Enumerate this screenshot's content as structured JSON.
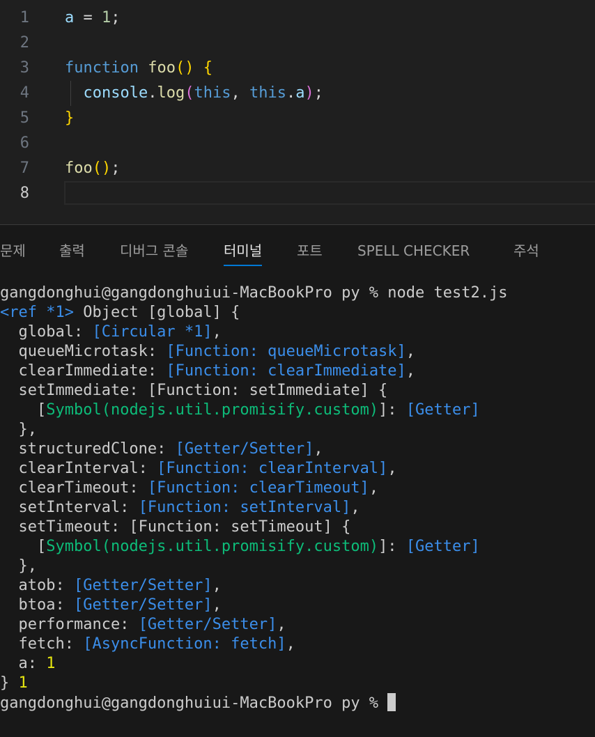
{
  "editor": {
    "active_line": 8,
    "lines": [
      {
        "no": "1",
        "tokens": [
          {
            "t": "a",
            "c": "var"
          },
          {
            "t": " = ",
            "c": "pn"
          },
          {
            "t": "1",
            "c": "num"
          },
          {
            "t": ";",
            "c": "pn"
          }
        ]
      },
      {
        "no": "2",
        "tokens": []
      },
      {
        "no": "3",
        "tokens": [
          {
            "t": "function",
            "c": "kw"
          },
          {
            "t": " ",
            "c": "pn"
          },
          {
            "t": "foo",
            "c": "fn"
          },
          {
            "t": "()",
            "c": "br1"
          },
          {
            "t": " ",
            "c": "pn"
          },
          {
            "t": "{",
            "c": "br1"
          }
        ]
      },
      {
        "no": "4",
        "tokens": [
          {
            "t": "  ",
            "c": "pn"
          },
          {
            "t": "console",
            "c": "var"
          },
          {
            "t": ".",
            "c": "pn"
          },
          {
            "t": "log",
            "c": "fn"
          },
          {
            "t": "(",
            "c": "br2"
          },
          {
            "t": "this",
            "c": "tv"
          },
          {
            "t": ", ",
            "c": "pn"
          },
          {
            "t": "this",
            "c": "tv"
          },
          {
            "t": ".",
            "c": "pn"
          },
          {
            "t": "a",
            "c": "var"
          },
          {
            "t": ")",
            "c": "br2"
          },
          {
            "t": ";",
            "c": "pn"
          }
        ]
      },
      {
        "no": "5",
        "tokens": [
          {
            "t": "}",
            "c": "br1"
          }
        ]
      },
      {
        "no": "6",
        "tokens": []
      },
      {
        "no": "7",
        "tokens": [
          {
            "t": "foo",
            "c": "fn"
          },
          {
            "t": "()",
            "c": "br1"
          },
          {
            "t": ";",
            "c": "pn"
          }
        ]
      },
      {
        "no": "8",
        "tokens": []
      }
    ]
  },
  "panel": {
    "tabs": [
      {
        "label": "문제",
        "active": false
      },
      {
        "label": "출력",
        "active": false
      },
      {
        "label": "디버그 콘솔",
        "active": false
      },
      {
        "label": "터미널",
        "active": true
      },
      {
        "label": "포트",
        "active": false
      },
      {
        "label": "SPELL CHECKER",
        "active": false
      },
      {
        "label": "주석",
        "active": false
      }
    ]
  },
  "terminal": {
    "lines": [
      [
        {
          "t": "gangdonghui@gangdonghuiui-MacBookPro py % node test2.js",
          "c": ""
        }
      ],
      [
        {
          "t": "<ref *1>",
          "c": "t-cyan"
        },
        {
          "t": " Object [global] {",
          "c": ""
        }
      ],
      [
        {
          "t": "  global: ",
          "c": ""
        },
        {
          "t": "[Circular *1]",
          "c": "t-cyan"
        },
        {
          "t": ",",
          "c": ""
        }
      ],
      [
        {
          "t": "  queueMicrotask: ",
          "c": ""
        },
        {
          "t": "[Function: queueMicrotask]",
          "c": "t-cyan"
        },
        {
          "t": ",",
          "c": ""
        }
      ],
      [
        {
          "t": "  clearImmediate: ",
          "c": ""
        },
        {
          "t": "[Function: clearImmediate]",
          "c": "t-cyan"
        },
        {
          "t": ",",
          "c": ""
        }
      ],
      [
        {
          "t": "  setImmediate: [Function: setImmediate] {",
          "c": ""
        }
      ],
      [
        {
          "t": "    [",
          "c": ""
        },
        {
          "t": "Symbol(nodejs.util.promisify.custom)",
          "c": "t-green2"
        },
        {
          "t": "]: ",
          "c": ""
        },
        {
          "t": "[Getter]",
          "c": "t-cyan"
        }
      ],
      [
        {
          "t": "  },",
          "c": ""
        }
      ],
      [
        {
          "t": "  structuredClone: ",
          "c": ""
        },
        {
          "t": "[Getter/Setter]",
          "c": "t-cyan"
        },
        {
          "t": ",",
          "c": ""
        }
      ],
      [
        {
          "t": "  clearInterval: ",
          "c": ""
        },
        {
          "t": "[Function: clearInterval]",
          "c": "t-cyan"
        },
        {
          "t": ",",
          "c": ""
        }
      ],
      [
        {
          "t": "  clearTimeout: ",
          "c": ""
        },
        {
          "t": "[Function: clearTimeout]",
          "c": "t-cyan"
        },
        {
          "t": ",",
          "c": ""
        }
      ],
      [
        {
          "t": "  setInterval: ",
          "c": ""
        },
        {
          "t": "[Function: setInterval]",
          "c": "t-cyan"
        },
        {
          "t": ",",
          "c": ""
        }
      ],
      [
        {
          "t": "  setTimeout: [Function: setTimeout] {",
          "c": ""
        }
      ],
      [
        {
          "t": "    [",
          "c": ""
        },
        {
          "t": "Symbol(nodejs.util.promisify.custom)",
          "c": "t-green2"
        },
        {
          "t": "]: ",
          "c": ""
        },
        {
          "t": "[Getter]",
          "c": "t-cyan"
        }
      ],
      [
        {
          "t": "  },",
          "c": ""
        }
      ],
      [
        {
          "t": "  atob: ",
          "c": ""
        },
        {
          "t": "[Getter/Setter]",
          "c": "t-cyan"
        },
        {
          "t": ",",
          "c": ""
        }
      ],
      [
        {
          "t": "  btoa: ",
          "c": ""
        },
        {
          "t": "[Getter/Setter]",
          "c": "t-cyan"
        },
        {
          "t": ",",
          "c": ""
        }
      ],
      [
        {
          "t": "  performance: ",
          "c": ""
        },
        {
          "t": "[Getter/Setter]",
          "c": "t-cyan"
        },
        {
          "t": ",",
          "c": ""
        }
      ],
      [
        {
          "t": "  fetch: ",
          "c": ""
        },
        {
          "t": "[AsyncFunction: fetch]",
          "c": "t-cyan"
        },
        {
          "t": ",",
          "c": ""
        }
      ],
      [
        {
          "t": "  a: ",
          "c": ""
        },
        {
          "t": "1",
          "c": "t-yellow"
        }
      ],
      [
        {
          "t": "} ",
          "c": ""
        },
        {
          "t": "1",
          "c": "t-yellow"
        }
      ],
      [
        {
          "t": "gangdonghui@gangdonghuiui-MacBookPro py % ",
          "c": ""
        }
      ]
    ]
  }
}
